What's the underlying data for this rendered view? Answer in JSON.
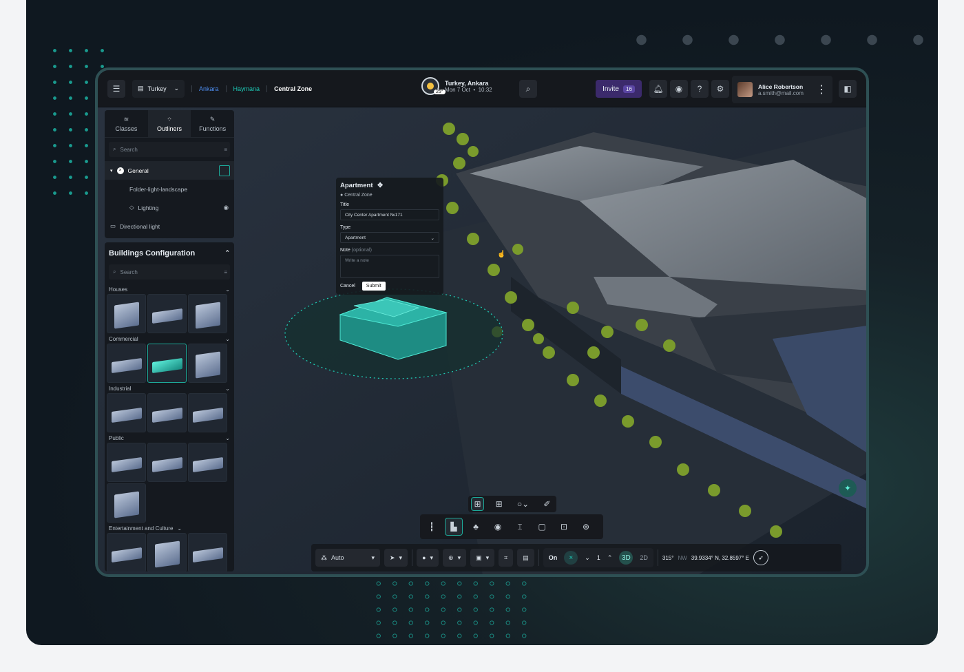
{
  "topbar": {
    "country": "Turkey",
    "breadcrumbs": [
      "Ankara",
      "Haymana",
      "Central Zone"
    ],
    "weather": {
      "location": "Turkey, Ankara",
      "temp": "25°",
      "date": "Mon 7 Oct",
      "time": "10:32"
    },
    "invite_label": "Invite",
    "invite_count": "16",
    "user": {
      "name": "Alice Robertson",
      "email": "a.smith@mail.com"
    }
  },
  "outliner": {
    "tabs": [
      "Classes",
      "Outliners",
      "Functions"
    ],
    "active_tab": "Outliners",
    "search_placeholder": "Search",
    "tree": [
      "General",
      "Folder-light-landscape",
      "Lighting",
      "Directional light"
    ]
  },
  "buildings": {
    "title": "Buildings Configuration",
    "search_placeholder": "Search",
    "categories": [
      "Houses",
      "Commercial",
      "Industrial",
      "Public",
      "Entertainment and Culture"
    ]
  },
  "popup": {
    "title": "Apartment",
    "location": "Central Zone",
    "title_label": "Title",
    "title_value": "City Center Apartment №171",
    "type_label": "Type",
    "type_value": "Apartment",
    "note_label": "Note",
    "note_optional": "(optional)",
    "note_placeholder": "Write a note",
    "cancel": "Cancel",
    "submit": "Submit"
  },
  "bottombar": {
    "mode": "Auto",
    "on_label": "On",
    "level": "1",
    "view_3d": "3D",
    "view_2d": "2D",
    "heading": "315°",
    "heading_dir": "NW",
    "coords": "39.9334° N, 32.8597° E"
  },
  "colors": {
    "accent": "#1da999",
    "invite": "#3b2a6b"
  }
}
